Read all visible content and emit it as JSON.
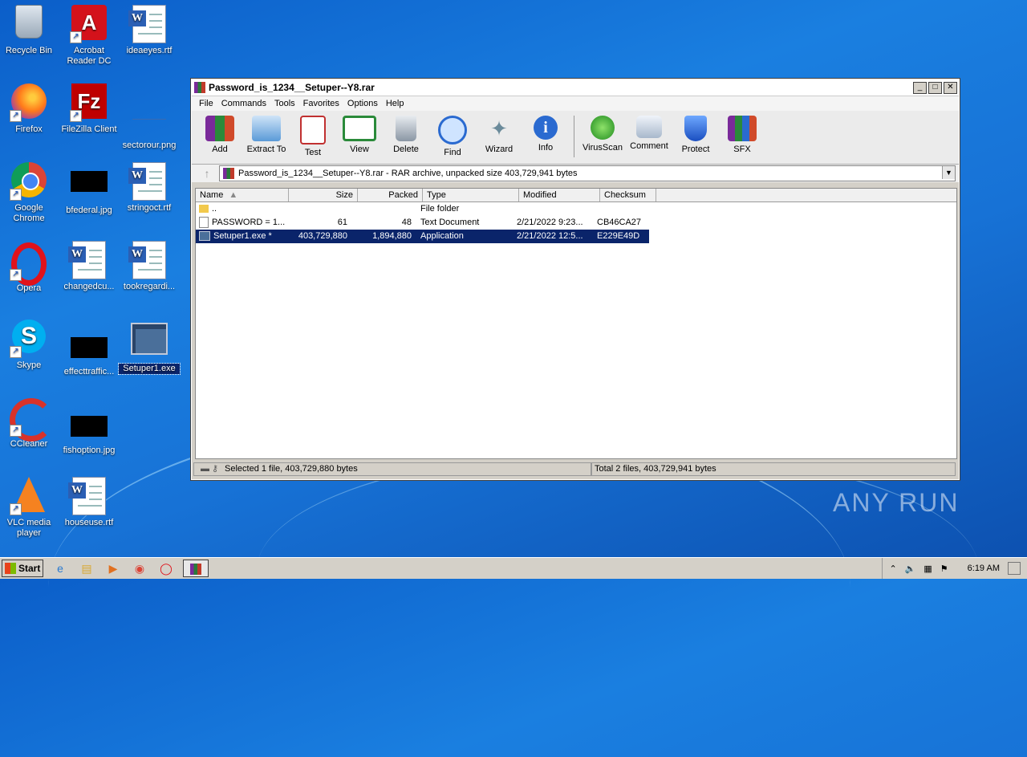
{
  "desktop_icons": [
    {
      "label": "Recycle Bin"
    },
    {
      "label": "Acrobat Reader DC"
    },
    {
      "label": "ideaeyes.rtf"
    },
    {
      "label": "Firefox"
    },
    {
      "label": "FileZilla Client"
    },
    {
      "label": "sectorour.png"
    },
    {
      "label": "Google Chrome"
    },
    {
      "label": "bfederal.jpg"
    },
    {
      "label": "stringoct.rtf"
    },
    {
      "label": "Opera"
    },
    {
      "label": "changedcu..."
    },
    {
      "label": "tookregardi..."
    },
    {
      "label": "Skype"
    },
    {
      "label": "effecttraffic..."
    },
    {
      "label": "Setuper1.exe"
    },
    {
      "label": "CCleaner"
    },
    {
      "label": "fishoption.jpg"
    },
    {
      "label": "VLC media player"
    },
    {
      "label": "houseuse.rtf"
    }
  ],
  "window": {
    "title": "Password_is_1234__Setuper--Y8.rar",
    "menu": [
      "File",
      "Commands",
      "Tools",
      "Favorites",
      "Options",
      "Help"
    ],
    "toolbar": [
      "Add",
      "Extract To",
      "Test",
      "View",
      "Delete",
      "Find",
      "Wizard",
      "Info",
      "VirusScan",
      "Comment",
      "Protect",
      "SFX"
    ],
    "address": "Password_is_1234__Setuper--Y8.rar - RAR archive, unpacked size 403,729,941 bytes",
    "columns": [
      "Name",
      "Size",
      "Packed",
      "Type",
      "Modified",
      "Checksum"
    ],
    "rows": [
      {
        "name": "..",
        "size": "",
        "packed": "",
        "type": "File folder",
        "modified": "",
        "checksum": ""
      },
      {
        "name": "PASSWORD = 1...",
        "size": "61",
        "packed": "48",
        "type": "Text Document",
        "modified": "2/21/2022 9:23...",
        "checksum": "CB46CA27"
      },
      {
        "name": "Setuper1.exe *",
        "size": "403,729,880",
        "packed": "1,894,880",
        "type": "Application",
        "modified": "2/21/2022 12:5...",
        "checksum": "E229E49D"
      }
    ],
    "status_left": "Selected 1 file, 403,729,880 bytes",
    "status_right": "Total 2 files, 403,729,941 bytes"
  },
  "taskbar": {
    "start": "Start",
    "clock": "6:19 AM"
  },
  "watermark": "ANY RUN"
}
